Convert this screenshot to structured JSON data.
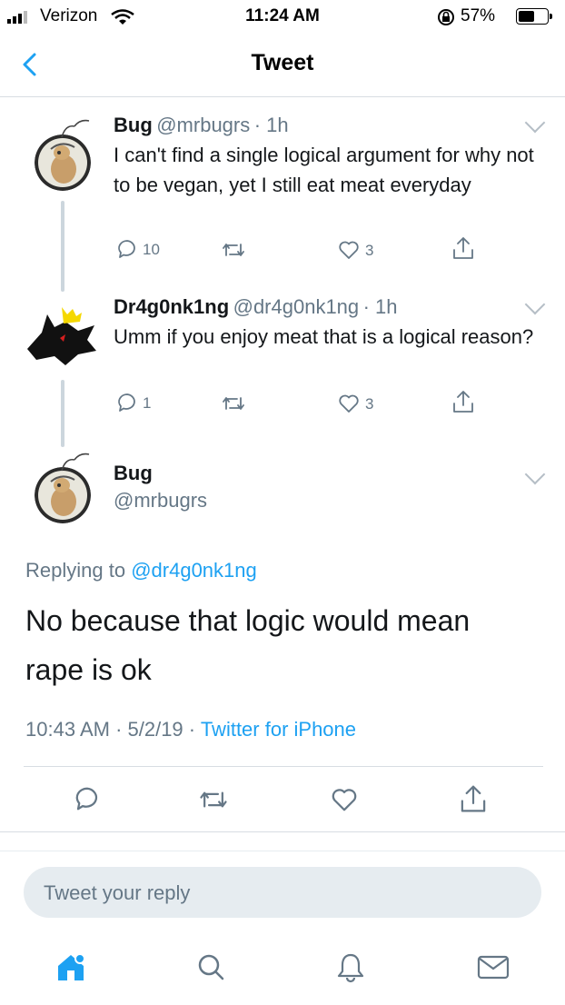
{
  "status_bar": {
    "carrier": "Verizon",
    "time": "11:24 AM",
    "battery": "57%",
    "battery_level": 0.57
  },
  "nav": {
    "title": "Tweet",
    "back_icon": "chevron-left-icon"
  },
  "thread": [
    {
      "name": "Bug",
      "handle": "@mrbugrs",
      "time": "· 1h",
      "text": "I can't find a single logical argument for why not to be vegan, yet I still eat meat everyday",
      "replies": "10",
      "likes": "3"
    },
    {
      "name": "Dr4g0nk1ng",
      "handle": "@dr4g0nk1ng",
      "time": "· 1h",
      "text": "Umm if you enjoy meat that is a logical reason?",
      "replies": "1",
      "likes": "3"
    }
  ],
  "main_tweet": {
    "name": "Bug",
    "handle": "@mrbugrs",
    "replying_prefix": "Replying to",
    "replying_to": "@dr4g0nk1ng",
    "text_line1": "No because that logic would mean",
    "text_line2": "rape is ok",
    "timestamp": "10:43 AM · 5/2/19 ·",
    "source": "Twitter for iPhone"
  },
  "reply_box": {
    "placeholder": "Tweet your reply"
  },
  "tab_bar": {
    "items": [
      "home-icon",
      "search-icon",
      "notifications-icon",
      "messages-icon"
    ]
  },
  "colors": {
    "accent": "#1da1f2",
    "secondary_text": "#657786",
    "divider": "#d8dde2"
  }
}
